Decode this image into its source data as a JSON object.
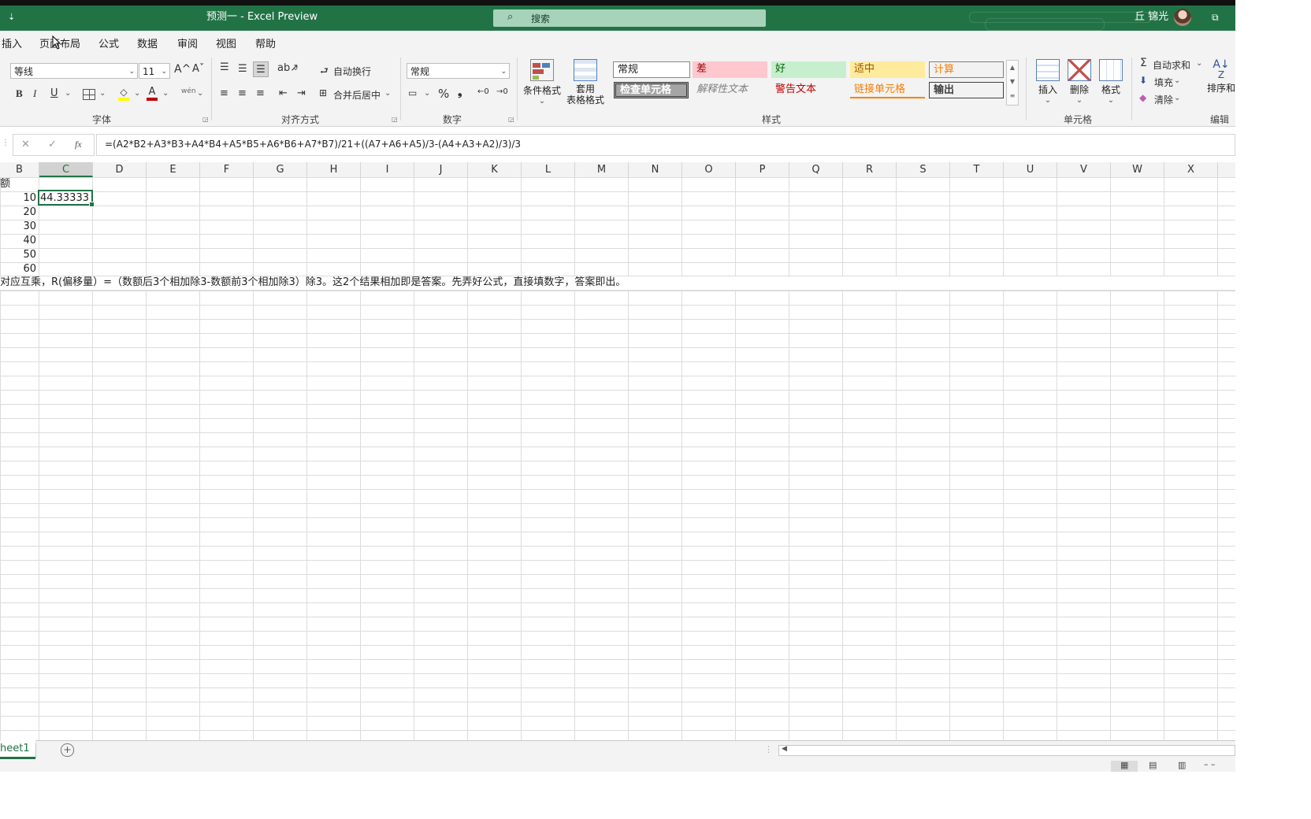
{
  "title_bar": {
    "quick_access": "⇣",
    "doc_title": "预测一  -  Excel Preview",
    "search_placeholder": "搜索",
    "user_name": "丘 锦光",
    "ribbon_display_icon": "ribbon-display-icon"
  },
  "tabs": [
    "插入",
    "页面布局",
    "公式",
    "数据",
    "审阅",
    "视图",
    "帮助"
  ],
  "ribbon": {
    "font_name": "等线",
    "font_size": "11",
    "grow_font": "A^",
    "shrink_font": "Aˇ",
    "bold": "B",
    "italic": "I",
    "underline": "U",
    "wen": "wén",
    "font_group": "字体",
    "wrap_text": "自动换行",
    "merge_center": "合并后居中",
    "align_group": "对齐方式",
    "number_format": "常规",
    "percent": "%",
    "comma": "❟",
    "number_group": "数字",
    "cond_format": "条件格式",
    "table_format_line1": "套用",
    "table_format_line2": "表格格式",
    "styles": {
      "normal": "常规",
      "bad": "差",
      "good": "好",
      "neutral": "适中",
      "calc": "计算",
      "check": "检查单元格",
      "explain": "解释性文本",
      "warn": "警告文本",
      "link": "链接单元格",
      "output": "输出"
    },
    "styles_group": "样式",
    "insert": "插入",
    "delete": "删除",
    "format": "格式",
    "cells_group": "单元格",
    "autosum": "自动求和",
    "fill": "填充",
    "clear": "清除",
    "sort": "排序和",
    "edit_group": "编辑"
  },
  "formula_bar": {
    "cancel": "✕",
    "enter": "✓",
    "fx": "fx",
    "formula": "=(A2*B2+A3*B3+A4*B4+A5*B5+A6*B6+A7*B7)/21+((A7+A6+A5)/3-(A4+A3+A2)/3)/3"
  },
  "columns": [
    "B",
    "C",
    "D",
    "E",
    "F",
    "G",
    "H",
    "I",
    "J",
    "K",
    "L",
    "M",
    "N",
    "O",
    "P",
    "Q",
    "R",
    "S",
    "T",
    "U",
    "V",
    "W",
    "X"
  ],
  "cells": {
    "b1": "额",
    "b_values": [
      "10",
      "20",
      "30",
      "40",
      "50",
      "60"
    ],
    "c2": "44.33333",
    "note": "对应互乘，R(偏移量）=（数额后3个相加除3-数额前3个相加除3）除3。这2个结果相加即是答案。先弄好公式，直接填数字，答案即出。"
  },
  "sheet_tab": "heet1",
  "add_sheet": "+",
  "colors": {
    "excel_green": "#217346",
    "selected_header": "#d2d2d2",
    "bad_bg": "#ffc7ce",
    "good_bg": "#c6efce",
    "neutral_bg": "#ffeb9c"
  }
}
